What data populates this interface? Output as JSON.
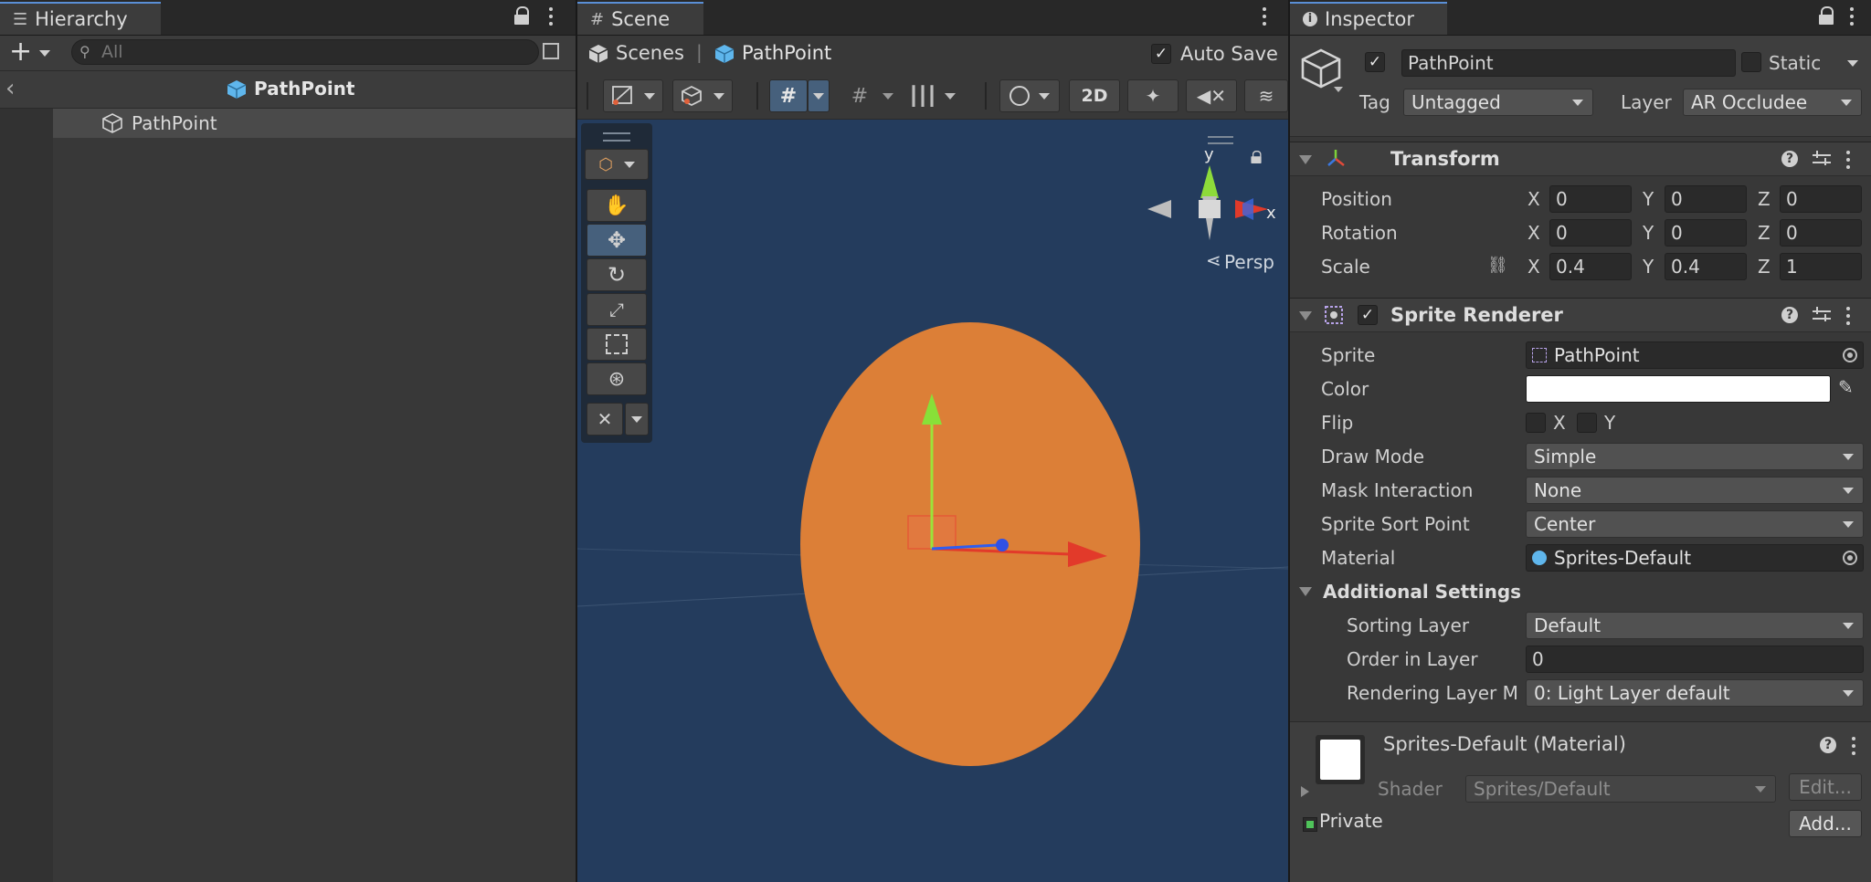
{
  "hierarchy": {
    "tab_label": "Hierarchy",
    "search_placeholder": "All",
    "scene_name": "PathPoint",
    "items": [
      {
        "label": "PathPoint"
      }
    ]
  },
  "scene": {
    "tab_label": "Scene",
    "breadcrumb": {
      "root": "Scenes",
      "separator": "|",
      "current": "PathPoint"
    },
    "auto_save_label": "Auto Save",
    "auto_save_checked": true,
    "btn_2d_label": "2D",
    "gizmo": {
      "y_label": "y",
      "x_label": "x",
      "projection_label": "Persp"
    },
    "sprite_color": "#dc7f37",
    "background_color": "#243c5d"
  },
  "inspector": {
    "tab_label": "Inspector",
    "object": {
      "active": true,
      "name": "PathPoint",
      "static_label": "Static",
      "tag_label": "Tag",
      "tag_value": "Untagged",
      "layer_label": "Layer",
      "layer_value": "AR Occludee"
    },
    "transform": {
      "title": "Transform",
      "rows": [
        {
          "label": "Position",
          "x": "0",
          "y": "0",
          "z": "0"
        },
        {
          "label": "Rotation",
          "x": "0",
          "y": "0",
          "z": "0"
        },
        {
          "label": "Scale",
          "x": "0.4",
          "y": "0.4",
          "z": "1"
        }
      ],
      "axis_x": "X",
      "axis_y": "Y",
      "axis_z": "Z"
    },
    "sprite_renderer": {
      "title": "Sprite Renderer",
      "enabled": true,
      "sprite_label": "Sprite",
      "sprite_value": "PathPoint",
      "color_label": "Color",
      "color_value": "#ffffff",
      "flip_label": "Flip",
      "flip_x": "X",
      "flip_y": "Y",
      "draw_mode_label": "Draw Mode",
      "draw_mode_value": "Simple",
      "mask_label": "Mask Interaction",
      "mask_value": "None",
      "sort_point_label": "Sprite Sort Point",
      "sort_point_value": "Center",
      "material_label": "Material",
      "material_value": "Sprites-Default",
      "additional_label": "Additional Settings",
      "sorting_layer_label": "Sorting Layer",
      "sorting_layer_value": "Default",
      "order_label": "Order in Layer",
      "order_value": "0",
      "rendering_label": "Rendering Layer M",
      "rendering_value": "0: Light Layer default"
    },
    "material": {
      "title": "Sprites-Default (Material)",
      "shader_label": "Shader",
      "shader_value": "Sprites/Default",
      "edit_label": "Edit...",
      "private_label": "Private",
      "add_label": "Add..."
    }
  }
}
